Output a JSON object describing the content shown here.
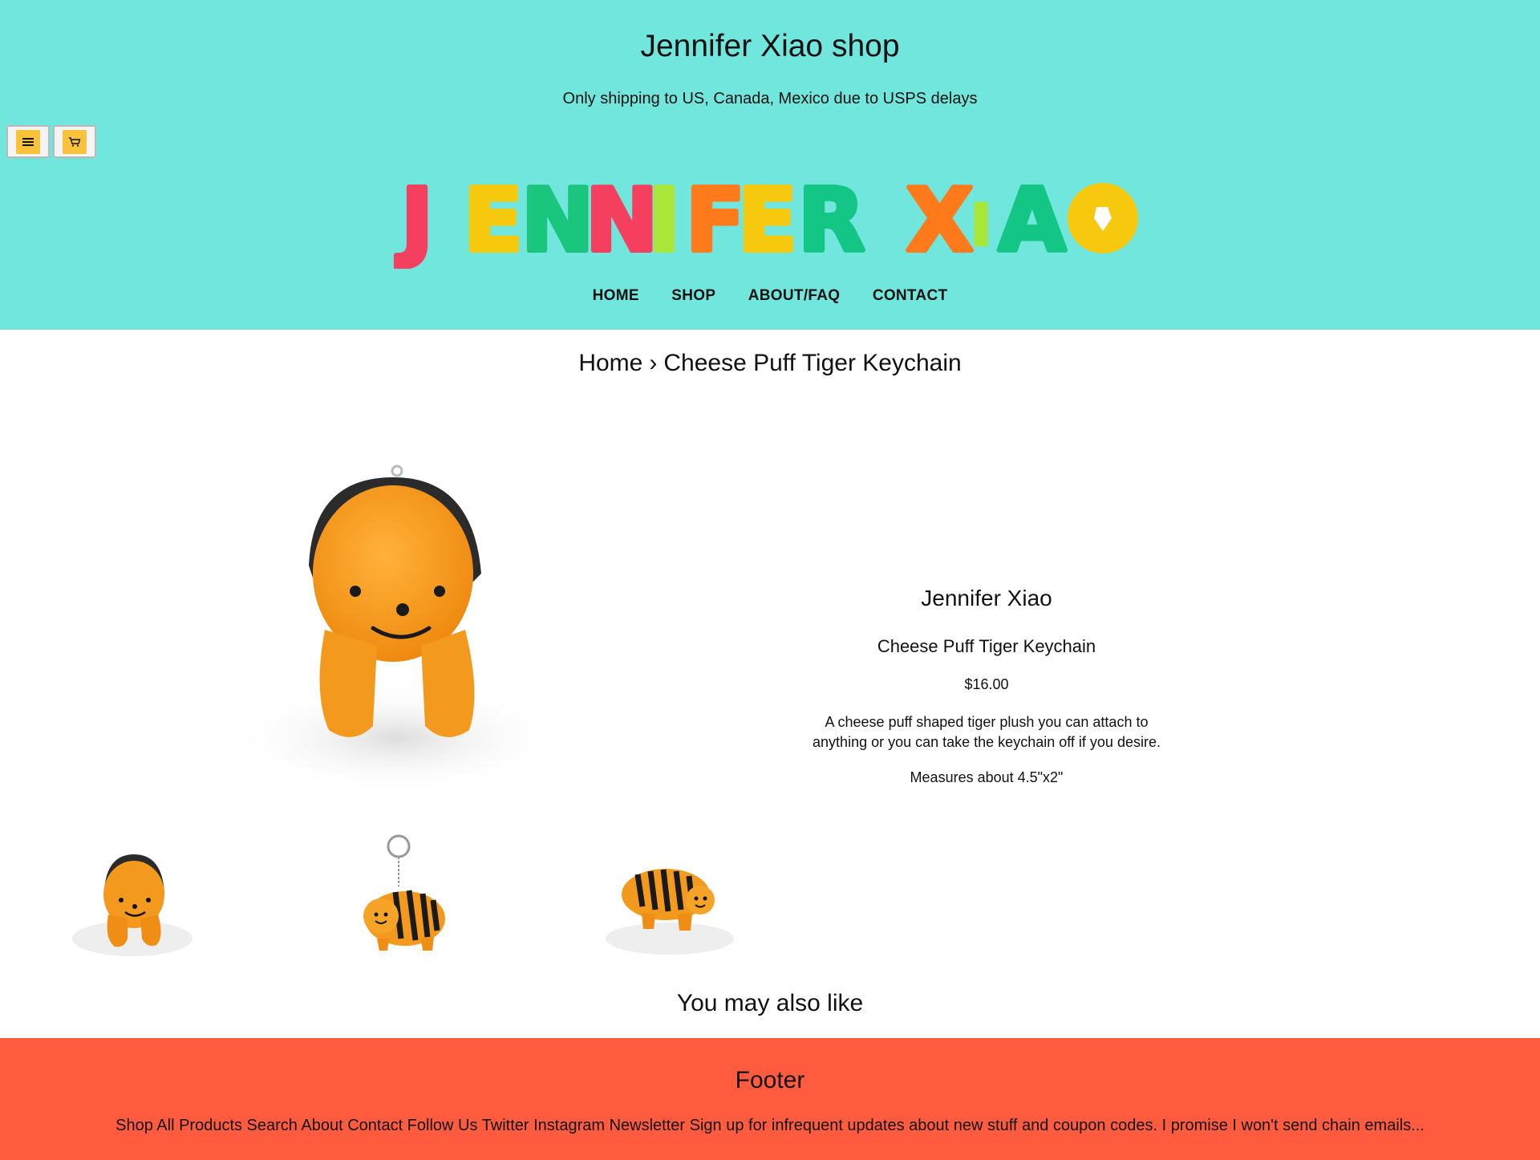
{
  "header": {
    "shop_title": "Jennifer Xiao shop",
    "announcement": "Only shipping to US, Canada, Mexico due to USPS delays",
    "logo_text": "JENNIFER XIAO",
    "menu_icon": "hamburger-menu-icon",
    "cart_icon": "shopping-cart-icon",
    "bg_color": "#71e6dd"
  },
  "nav": {
    "items": [
      "HOME",
      "SHOP",
      "ABOUT/FAQ",
      "CONTACT"
    ]
  },
  "breadcrumb": {
    "home": "Home",
    "separator": "›",
    "current": "Cheese Puff Tiger Keychain"
  },
  "product": {
    "vendor": "Jennifer Xiao",
    "name": "Cheese Puff Tiger Keychain",
    "price": "$16.00",
    "description": "A cheese puff shaped tiger plush you can attach to anything or you can take the keychain off if you desire.",
    "measurements": "Measures about 4.5\"x2\""
  },
  "related": {
    "heading": "You may also like"
  },
  "footer": {
    "title": "Footer",
    "links_text": "Shop All Products Search About Contact Follow Us Twitter Instagram Newsletter Sign up for infrequent updates about new stuff and coupon codes. I promise I won't send chain emails...",
    "bg_color": "#ff5c3f"
  }
}
